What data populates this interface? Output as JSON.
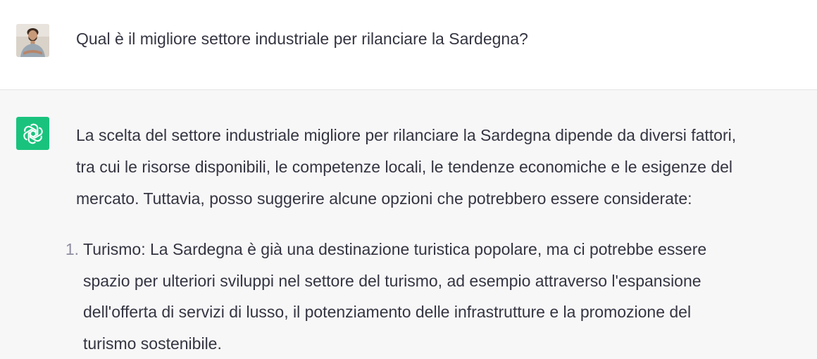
{
  "user": {
    "avatar_icon": "user-avatar-photo",
    "question": "Qual è il migliore settore industriale per rilanciare la Sardegna?"
  },
  "assistant": {
    "icon": "openai-logo-icon",
    "brand_color": "#19c37d",
    "intro_lines": [
      "La scelta del settore industriale migliore per rilanciare la Sardegna dipende da diversi fattori,",
      "tra cui le risorse disponibili, le competenze locali, le tendenze economiche e le esigenze del",
      "mercato. Tuttavia, posso suggerire alcune opzioni che potrebbero essere considerate:"
    ],
    "list": [
      {
        "number": "1.",
        "lines": [
          "Turismo: La Sardegna è già una destinazione turistica popolare, ma ci potrebbe essere",
          "spazio per ulteriori sviluppi nel settore del turismo, ad esempio attraverso l'espansione",
          "dell'offerta di servizi di lusso, il potenziamento delle infrastrutture e la promozione del",
          "turismo sostenibile."
        ]
      }
    ]
  }
}
